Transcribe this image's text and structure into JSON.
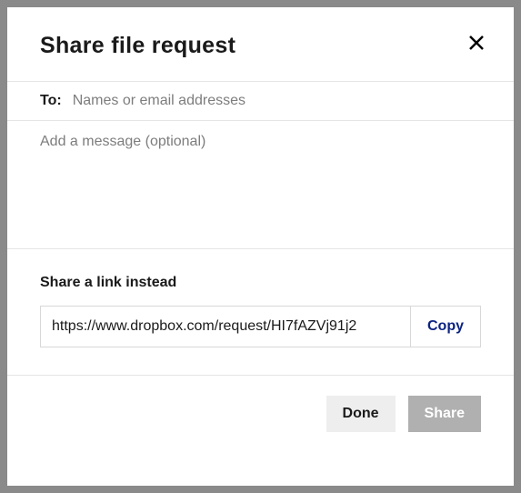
{
  "modal": {
    "title": "Share file request",
    "to_label": "To:",
    "to_placeholder": "Names or email addresses",
    "message_placeholder": "Add a message (optional)",
    "link_section_title": "Share a link instead",
    "link_value": "https://www.dropbox.com/request/HI7fAZVj91j2",
    "copy_label": "Copy",
    "done_label": "Done",
    "share_label": "Share"
  }
}
